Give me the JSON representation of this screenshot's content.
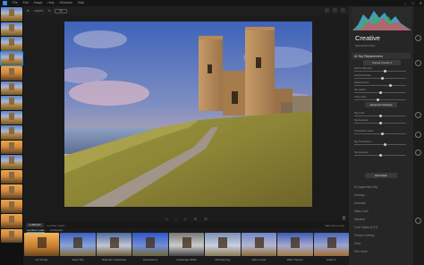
{
  "menu": {
    "items": [
      "File",
      "Edit",
      "Image",
      "Help",
      "Windows",
      "Help"
    ]
  },
  "window": {
    "minimize": "–",
    "maximize": "□",
    "close": "✕"
  },
  "toolbar": {
    "items": [
      "⊕",
      "Layers",
      "⊖",
      "Fit",
      "100%"
    ],
    "zoom_value": "Fit"
  },
  "left_strip": {
    "thumb_count": 16,
    "selected_index": 3
  },
  "canvas_bottom": {
    "icons": [
      "◁",
      "□",
      "▷",
      "⊡",
      "⊟"
    ],
    "trash": "🗑"
  },
  "presets": {
    "tag": "LUMINAR",
    "label": "Luminar Looks",
    "right_label": "Save New Look...",
    "categories": [
      "Luminar Looks",
      "Landscape"
    ],
    "active_category": 0,
    "tiles": [
      {
        "name": "Air Cloudy",
        "style": "warm"
      },
      {
        "name": "Deep Sky",
        "style": "blue"
      },
      {
        "name": "Dramatic Landscape",
        "style": "dramatic"
      },
      {
        "name": "Impressions",
        "style": "blue2"
      },
      {
        "name": "Landscape B&W",
        "style": "bw"
      },
      {
        "name": "Morning Fog",
        "style": "fog"
      },
      {
        "name": "Warm Land",
        "style": "warm2"
      },
      {
        "name": "Warm Sunset",
        "style": "sunset"
      },
      {
        "name": "Autumn",
        "style": "autumn"
      }
    ]
  },
  "right_panel": {
    "title": "Creative",
    "subtitle": "DESCEND RAW",
    "section": "AI Sky Replacement",
    "dropdown": "Sunset Clouds 1",
    "button_adv": "Advanced Settings",
    "button_edit": "Edit Mask",
    "sliders": [
      {
        "label": "Horizon Blending",
        "value": 0.6
      },
      {
        "label": "Horizon Position",
        "value": 0.55
      },
      {
        "label": "Relight Scene",
        "value": 0.7
      },
      {
        "label": "Sky Global",
        "value": 0.5
      },
      {
        "label": "Close Gaps",
        "value": 0.45
      },
      {
        "label": "Sky Local",
        "value": 0.5
      },
      {
        "label": "Sky Exposure",
        "value": 0.5
      },
      {
        "label": "Atmospheric Haze",
        "value": 0.55
      },
      {
        "label": "Sky Temperature",
        "value": 0.6
      },
      {
        "label": "Sky Exposure",
        "value": 0.5
      }
    ],
    "tools": [
      "AI Augmented Sky",
      "Sunrays",
      "Dramatic",
      "Matte Look",
      "Mystical",
      "Color Styles (LUT)",
      "Texture Overlay",
      "Glow",
      "Film Grain"
    ]
  },
  "side_icons": [
    "layers-icon",
    "adjust-icon",
    "palette-icon",
    "face-icon",
    "portrait-icon",
    "info-icon"
  ]
}
